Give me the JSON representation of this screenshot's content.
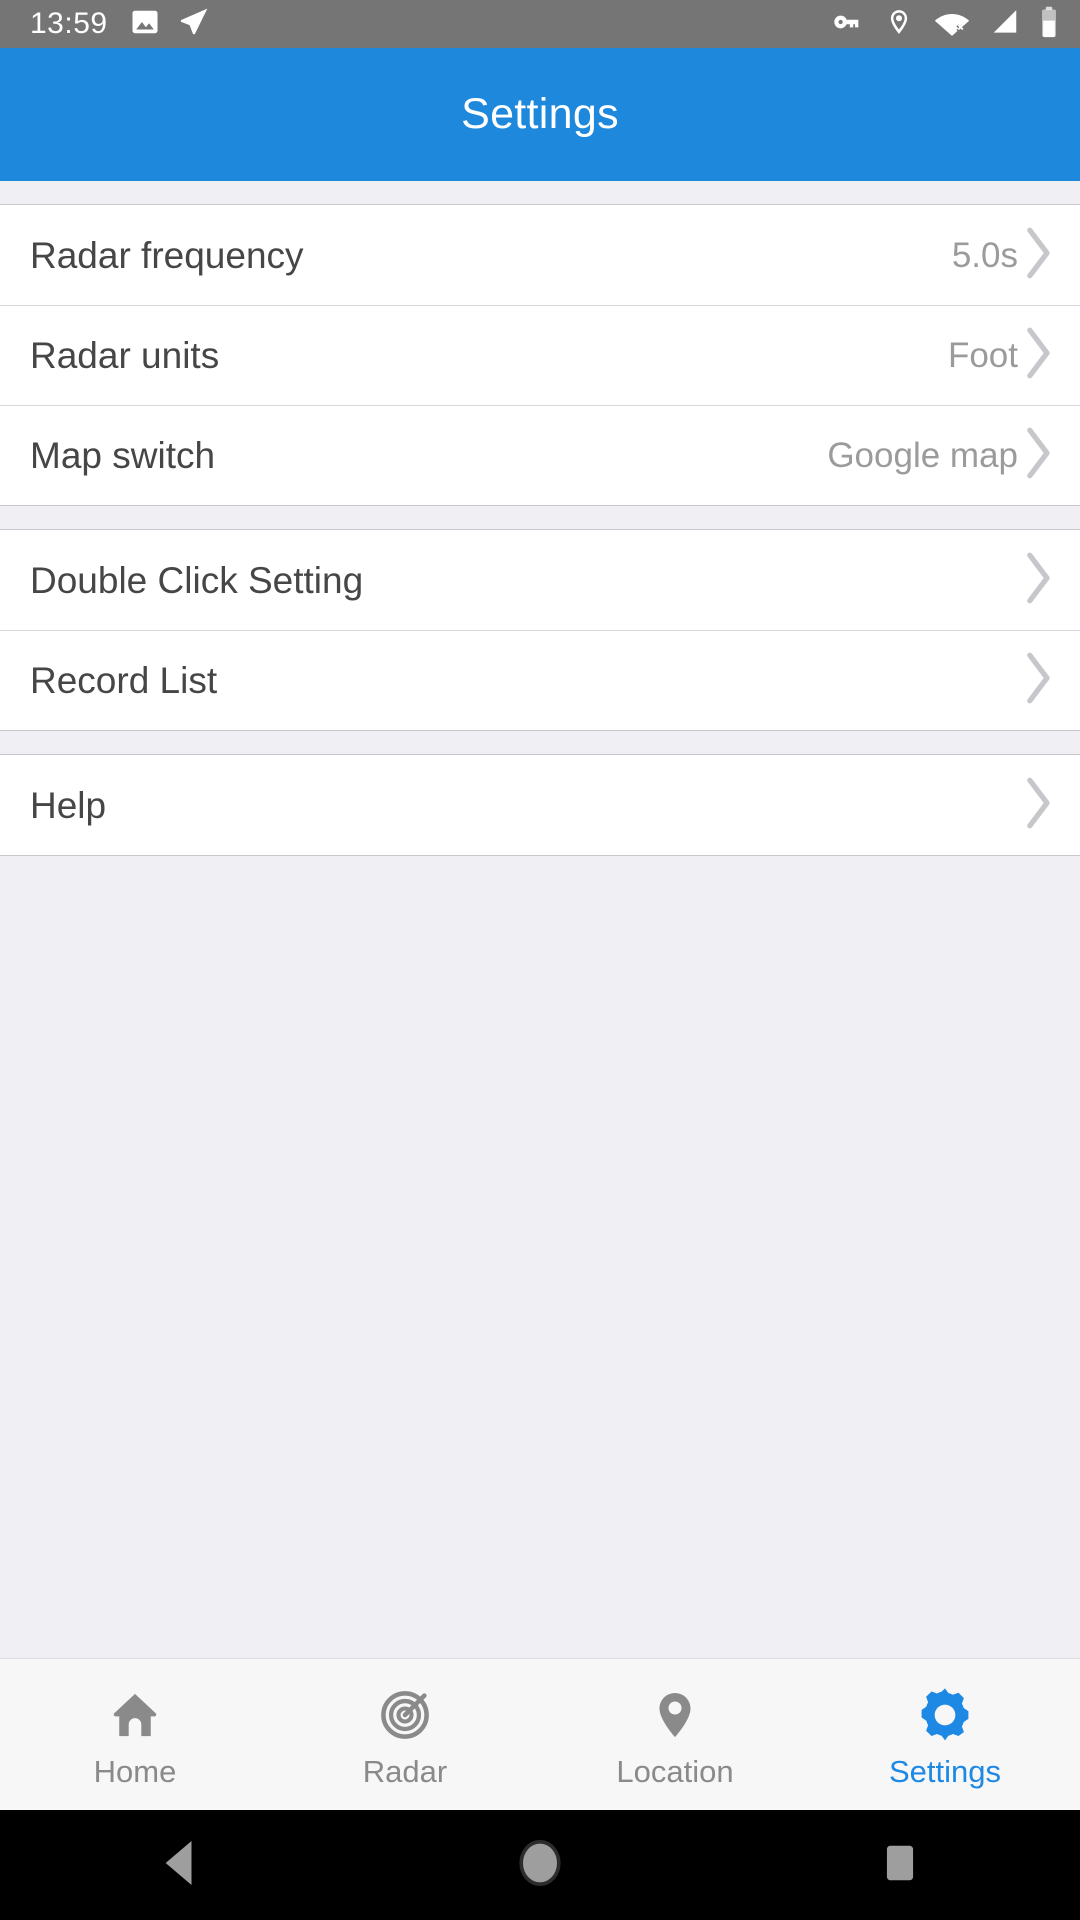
{
  "status_bar": {
    "time": "13:59",
    "left_icons": [
      "image-icon",
      "send-icon"
    ],
    "right_icons": [
      "vpn-key-icon",
      "location-pin-icon",
      "wifi-off-icon",
      "cellular-signal-icon",
      "battery-icon"
    ],
    "background_color": "#757575",
    "foreground_color": "#FFFFFF"
  },
  "app_bar": {
    "title": "Settings",
    "background_color": "#1E88DC",
    "title_color": "#FFFFFF"
  },
  "settings": {
    "groups": [
      {
        "rows": [
          {
            "label": "Radar frequency",
            "value": "5.0s",
            "chevron": "chevron-right-icon"
          },
          {
            "label": "Radar units",
            "value": "Foot",
            "chevron": "chevron-right-icon"
          },
          {
            "label": "Map switch",
            "value": "Google map",
            "chevron": "chevron-right-icon"
          }
        ]
      },
      {
        "rows": [
          {
            "label": "Double Click Setting",
            "value": "",
            "chevron": "chevron-right-icon"
          },
          {
            "label": "Record List",
            "value": "",
            "chevron": "chevron-right-icon"
          }
        ]
      },
      {
        "rows": [
          {
            "label": "Help",
            "value": "",
            "chevron": "chevron-right-icon"
          }
        ]
      }
    ],
    "row_background": "#FFFFFF",
    "page_background": "#EFEFF4",
    "label_color": "#464646",
    "value_color": "#9B9B9B"
  },
  "tab_bar": {
    "background_color": "#F7F7F7",
    "inactive_color": "#8A8A8A",
    "active_color": "#1E88E5",
    "tabs": [
      {
        "label": "Home",
        "icon": "home-icon",
        "active": false
      },
      {
        "label": "Radar",
        "icon": "radar-target-icon",
        "active": false
      },
      {
        "label": "Location",
        "icon": "location-pin-icon",
        "active": false
      },
      {
        "label": "Settings",
        "icon": "gear-icon",
        "active": true
      }
    ]
  },
  "android_nav_bar": {
    "background_color": "#000000",
    "buttons": [
      {
        "name": "back-button",
        "icon": "triangle-back-icon"
      },
      {
        "name": "home-button",
        "icon": "circle-home-icon"
      },
      {
        "name": "recents-button",
        "icon": "square-recents-icon"
      }
    ]
  }
}
